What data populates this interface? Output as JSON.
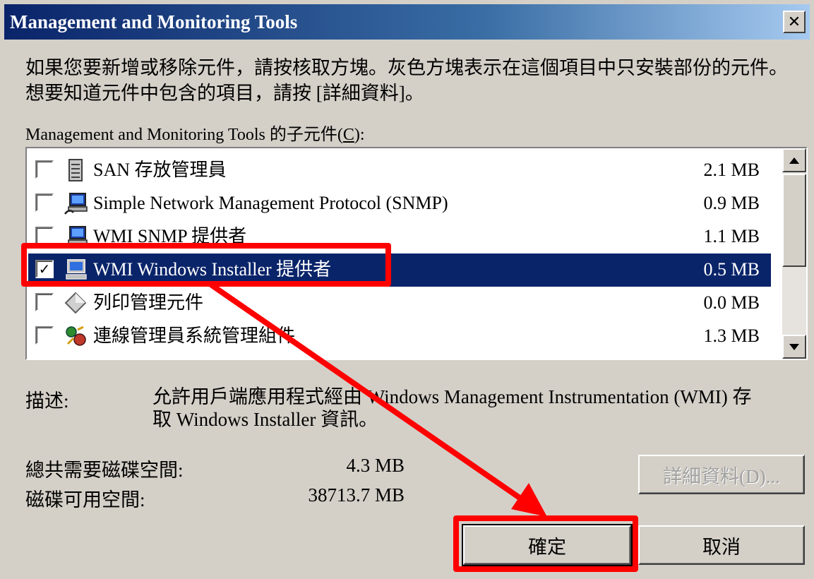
{
  "window": {
    "title": "Management and Monitoring Tools",
    "close_glyph": "✕"
  },
  "instructions": "如果您要新增或移除元件，請按核取方塊。灰色方塊表示在這個項目中只安裝部份的元件。想要知道元件中包含的項目，請按 [詳細資料]。",
  "list": {
    "label_prefix": "Management and Monitoring Tools 的子元件(",
    "label_accel": "C",
    "label_suffix": "):",
    "items": [
      {
        "label": "SAN 存放管理員",
        "size": "2.1 MB",
        "checked": false,
        "selected": false,
        "icon": "server-icon"
      },
      {
        "label": "Simple Network Management Protocol (SNMP)",
        "size": "0.9 MB",
        "checked": false,
        "selected": false,
        "icon": "network-computer-icon"
      },
      {
        "label": "WMI SNMP 提供者",
        "size": "1.1 MB",
        "checked": false,
        "selected": false,
        "icon": "network-computer-icon"
      },
      {
        "label": "WMI Windows Installer 提供者",
        "size": "0.5 MB",
        "checked": true,
        "selected": true,
        "icon": "computer-icon"
      },
      {
        "label": "列印管理元件",
        "size": "0.0 MB",
        "checked": false,
        "selected": false,
        "icon": "diamond-icon"
      },
      {
        "label": "連線管理員系統管理組件",
        "size": "1.3 MB",
        "checked": false,
        "selected": false,
        "icon": "connection-manager-icon"
      }
    ]
  },
  "description": {
    "label": "描述:",
    "text": "允許用戶端應用程式經由 Windows Management Instrumentation (WMI) 存取 Windows Installer 資訊。"
  },
  "disk": {
    "total_label": "總共需要磁碟空間:",
    "total_value": "4.3 MB",
    "free_label": "磁碟可用空間:",
    "free_value": "38713.7 MB"
  },
  "buttons": {
    "details": "詳細資料(D)...",
    "ok": "確定",
    "cancel": "取消"
  },
  "colors": {
    "title_bar": "#0a246a",
    "selection": "#0a246a",
    "annotation": "#ff0000",
    "dialog_face": "#d4d0c8"
  }
}
